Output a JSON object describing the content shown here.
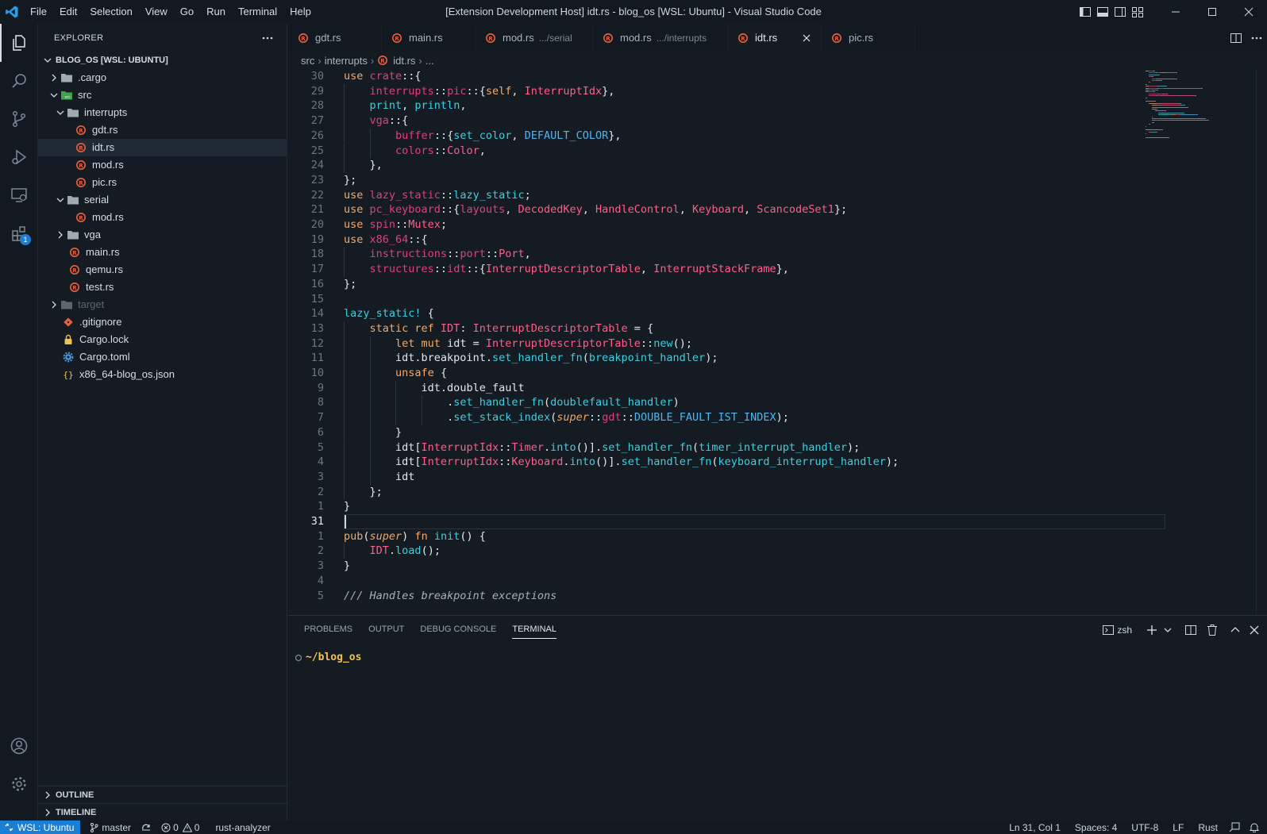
{
  "window": {
    "title": "[Extension Development Host] idt.rs - blog_os [WSL: Ubuntu] - Visual Studio Code",
    "menus": [
      "File",
      "Edit",
      "Selection",
      "View",
      "Go",
      "Run",
      "Terminal",
      "Help"
    ]
  },
  "colors": {
    "accent": "#1a7fd4",
    "rust_icon": "#e8613c",
    "folder": "#b9c3cc"
  },
  "activity": {
    "extensions_badge": "1"
  },
  "sidebar": {
    "title": "EXPLORER",
    "root": "BLOG_OS [WSL: UBUNTU]",
    "tree": [
      {
        "label": ".cargo",
        "depth": 1,
        "type": "folder",
        "expanded": false
      },
      {
        "label": "src",
        "depth": 1,
        "type": "folder-src",
        "expanded": true
      },
      {
        "label": "interrupts",
        "depth": 2,
        "type": "folder",
        "expanded": true
      },
      {
        "label": "gdt.rs",
        "depth": 3,
        "type": "rust"
      },
      {
        "label": "idt.rs",
        "depth": 3,
        "type": "rust",
        "selected": true
      },
      {
        "label": "mod.rs",
        "depth": 3,
        "type": "rust"
      },
      {
        "label": "pic.rs",
        "depth": 3,
        "type": "rust"
      },
      {
        "label": "serial",
        "depth": 2,
        "type": "folder",
        "expanded": true
      },
      {
        "label": "mod.rs",
        "depth": 3,
        "type": "rust"
      },
      {
        "label": "vga",
        "depth": 2,
        "type": "folder",
        "expanded": false
      },
      {
        "label": "main.rs",
        "depth": 2,
        "type": "rust"
      },
      {
        "label": "qemu.rs",
        "depth": 2,
        "type": "rust"
      },
      {
        "label": "test.rs",
        "depth": 2,
        "type": "rust"
      },
      {
        "label": "target",
        "depth": 1,
        "type": "folder-dim",
        "expanded": false
      },
      {
        "label": ".gitignore",
        "depth": 1,
        "type": "git"
      },
      {
        "label": "Cargo.lock",
        "depth": 1,
        "type": "lock"
      },
      {
        "label": "Cargo.toml",
        "depth": 1,
        "type": "gear"
      },
      {
        "label": "x86_64-blog_os.json",
        "depth": 1,
        "type": "json"
      }
    ],
    "sections": [
      "OUTLINE",
      "TIMELINE"
    ]
  },
  "tabs": [
    {
      "label": "gdt.rs",
      "desc": ""
    },
    {
      "label": "main.rs",
      "desc": ""
    },
    {
      "label": "mod.rs",
      "desc": ".../serial"
    },
    {
      "label": "mod.rs",
      "desc": ".../interrupts"
    },
    {
      "label": "idt.rs",
      "desc": "",
      "active": true
    },
    {
      "label": "pic.rs",
      "desc": ""
    }
  ],
  "breadcrumb": {
    "parts": [
      "src",
      "interrupts",
      "idt.rs",
      "..."
    ]
  },
  "editor": {
    "cursor_line": 31,
    "lines": [
      {
        "n": "30",
        "indent": 0,
        "t": [
          [
            "kw",
            "use "
          ],
          [
            "md",
            "crate"
          ],
          [
            "pn",
            "::{"
          ]
        ]
      },
      {
        "n": "29",
        "indent": 1,
        "t": [
          [
            "md",
            "interrupts"
          ],
          [
            "pn",
            "::"
          ],
          [
            "md",
            "pic"
          ],
          [
            "pn",
            "::{"
          ],
          [
            "kw",
            "self"
          ],
          [
            "pn",
            ", "
          ],
          [
            "ty",
            "InterruptIdx"
          ],
          [
            "pn",
            "},"
          ]
        ]
      },
      {
        "n": "28",
        "indent": 1,
        "t": [
          [
            "mac",
            "print"
          ],
          [
            "pn",
            ", "
          ],
          [
            "mac",
            "println"
          ],
          [
            "pn",
            ","
          ]
        ]
      },
      {
        "n": "27",
        "indent": 1,
        "t": [
          [
            "md",
            "vga"
          ],
          [
            "pn",
            "::{"
          ]
        ]
      },
      {
        "n": "26",
        "indent": 2,
        "t": [
          [
            "md",
            "buffer"
          ],
          [
            "pn",
            "::{"
          ],
          [
            "fn",
            "set_color"
          ],
          [
            "pn",
            ", "
          ],
          [
            "cst",
            "DEFAULT_COLOR"
          ],
          [
            "pn",
            "},"
          ]
        ]
      },
      {
        "n": "25",
        "indent": 2,
        "t": [
          [
            "md",
            "colors"
          ],
          [
            "pn",
            "::"
          ],
          [
            "ty",
            "Color"
          ],
          [
            "pn",
            ","
          ]
        ]
      },
      {
        "n": "24",
        "indent": 1,
        "t": [
          [
            "pn",
            "},"
          ]
        ]
      },
      {
        "n": "23",
        "indent": 0,
        "t": [
          [
            "pn",
            "};"
          ]
        ]
      },
      {
        "n": "22",
        "indent": 0,
        "t": [
          [
            "kw",
            "use "
          ],
          [
            "md",
            "lazy_static"
          ],
          [
            "pn",
            "::"
          ],
          [
            "mac",
            "lazy_static"
          ],
          [
            "pn",
            ";"
          ]
        ]
      },
      {
        "n": "21",
        "indent": 0,
        "t": [
          [
            "kw",
            "use "
          ],
          [
            "md",
            "pc_keyboard"
          ],
          [
            "pn",
            "::{"
          ],
          [
            "md",
            "layouts"
          ],
          [
            "pn",
            ", "
          ],
          [
            "ty",
            "DecodedKey"
          ],
          [
            "pn",
            ", "
          ],
          [
            "ty",
            "HandleControl"
          ],
          [
            "pn",
            ", "
          ],
          [
            "ty",
            "Keyboard"
          ],
          [
            "pn",
            ", "
          ],
          [
            "ty",
            "ScancodeSet1"
          ],
          [
            "pn",
            "};"
          ]
        ]
      },
      {
        "n": "20",
        "indent": 0,
        "t": [
          [
            "kw",
            "use "
          ],
          [
            "md",
            "spin"
          ],
          [
            "pn",
            "::"
          ],
          [
            "ty",
            "Mutex"
          ],
          [
            "pn",
            ";"
          ]
        ]
      },
      {
        "n": "19",
        "indent": 0,
        "t": [
          [
            "kw",
            "use "
          ],
          [
            "md",
            "x86_64"
          ],
          [
            "pn",
            "::{"
          ]
        ]
      },
      {
        "n": "18",
        "indent": 1,
        "t": [
          [
            "md",
            "instructions"
          ],
          [
            "pn",
            "::"
          ],
          [
            "md",
            "port"
          ],
          [
            "pn",
            "::"
          ],
          [
            "ty",
            "Port"
          ],
          [
            "pn",
            ","
          ]
        ]
      },
      {
        "n": "17",
        "indent": 1,
        "t": [
          [
            "md",
            "structures"
          ],
          [
            "pn",
            "::"
          ],
          [
            "md",
            "idt"
          ],
          [
            "pn",
            "::{"
          ],
          [
            "ty",
            "InterruptDescriptorTable"
          ],
          [
            "pn",
            ", "
          ],
          [
            "ty",
            "InterruptStackFrame"
          ],
          [
            "pn",
            "},"
          ]
        ]
      },
      {
        "n": "16",
        "indent": 0,
        "t": [
          [
            "pn",
            "};"
          ]
        ]
      },
      {
        "n": "15",
        "indent": 0,
        "t": []
      },
      {
        "n": "14",
        "indent": 0,
        "t": [
          [
            "mac",
            "lazy_static!"
          ],
          [
            "pn",
            " {"
          ]
        ]
      },
      {
        "n": "13",
        "indent": 1,
        "t": [
          [
            "kw",
            "static ref "
          ],
          [
            "ty",
            "IDT"
          ],
          [
            "pn",
            ": "
          ],
          [
            "ty",
            "InterruptDescriptorTable"
          ],
          [
            "pn",
            " = {"
          ]
        ]
      },
      {
        "n": "12",
        "indent": 2,
        "t": [
          [
            "kw",
            "let mut "
          ],
          [
            "pn",
            "idt = "
          ],
          [
            "ty",
            "InterruptDescriptorTable"
          ],
          [
            "pn",
            "::"
          ],
          [
            "fn",
            "new"
          ],
          [
            "pn",
            "();"
          ]
        ]
      },
      {
        "n": "11",
        "indent": 2,
        "t": [
          [
            "pn",
            "idt.breakpoint."
          ],
          [
            "fn",
            "set_handler_fn"
          ],
          [
            "pn",
            "("
          ],
          [
            "fn",
            "breakpoint_handler"
          ],
          [
            "pn",
            ");"
          ]
        ]
      },
      {
        "n": "10",
        "indent": 2,
        "t": [
          [
            "kw",
            "unsafe"
          ],
          [
            "pn",
            " {"
          ]
        ]
      },
      {
        "n": "9",
        "indent": 3,
        "t": [
          [
            "pn",
            "idt.double_fault"
          ]
        ]
      },
      {
        "n": "8",
        "indent": 4,
        "t": [
          [
            "pn",
            "."
          ],
          [
            "fn",
            "set_handler_fn"
          ],
          [
            "pn",
            "("
          ],
          [
            "fn",
            "doublefault_handler"
          ],
          [
            "pn",
            ")"
          ]
        ]
      },
      {
        "n": "7",
        "indent": 4,
        "t": [
          [
            "pn",
            "."
          ],
          [
            "fn",
            "set_stack_index"
          ],
          [
            "pn",
            "("
          ],
          [
            "it",
            "super"
          ],
          [
            "pn",
            "::"
          ],
          [
            "md",
            "gdt"
          ],
          [
            "pn",
            "::"
          ],
          [
            "cst",
            "DOUBLE_FAULT_IST_INDEX"
          ],
          [
            "pn",
            ");"
          ]
        ]
      },
      {
        "n": "6",
        "indent": 2,
        "t": [
          [
            "pn",
            "}"
          ]
        ]
      },
      {
        "n": "5",
        "indent": 2,
        "t": [
          [
            "pn",
            "idt["
          ],
          [
            "ty",
            "InterruptIdx"
          ],
          [
            "pn",
            "::"
          ],
          [
            "ty",
            "Timer"
          ],
          [
            "pn",
            "."
          ],
          [
            "fn",
            "into"
          ],
          [
            "pn",
            "()]."
          ],
          [
            "fn",
            "set_handler_fn"
          ],
          [
            "pn",
            "("
          ],
          [
            "fn",
            "timer_interrupt_handler"
          ],
          [
            "pn",
            ");"
          ]
        ]
      },
      {
        "n": "4",
        "indent": 2,
        "t": [
          [
            "pn",
            "idt["
          ],
          [
            "ty",
            "InterruptIdx"
          ],
          [
            "pn",
            "::"
          ],
          [
            "ty",
            "Keyboard"
          ],
          [
            "pn",
            "."
          ],
          [
            "fn",
            "into"
          ],
          [
            "pn",
            "()]."
          ],
          [
            "fn",
            "set_handler_fn"
          ],
          [
            "pn",
            "("
          ],
          [
            "fn",
            "keyboard_interrupt_handler"
          ],
          [
            "pn",
            ");"
          ]
        ]
      },
      {
        "n": "3",
        "indent": 2,
        "t": [
          [
            "pn",
            "idt"
          ]
        ]
      },
      {
        "n": "2",
        "indent": 1,
        "t": [
          [
            "pn",
            "};"
          ]
        ]
      },
      {
        "n": "1",
        "indent": 0,
        "t": [
          [
            "pn",
            "}"
          ]
        ]
      },
      {
        "n": "31",
        "indent": 0,
        "t": [],
        "cur": true
      },
      {
        "n": "1",
        "indent": 0,
        "t": [
          [
            "kw",
            "pub"
          ],
          [
            "pn",
            "("
          ],
          [
            "it",
            "super"
          ],
          [
            "pn",
            ") "
          ],
          [
            "kw",
            "fn "
          ],
          [
            "fn",
            "init"
          ],
          [
            "pn",
            "() {"
          ]
        ]
      },
      {
        "n": "2",
        "indent": 1,
        "t": [
          [
            "ty",
            "IDT"
          ],
          [
            "pn",
            "."
          ],
          [
            "fn",
            "load"
          ],
          [
            "pn",
            "();"
          ]
        ]
      },
      {
        "n": "3",
        "indent": 0,
        "t": [
          [
            "pn",
            "}"
          ]
        ]
      },
      {
        "n": "4",
        "indent": 0,
        "t": []
      },
      {
        "n": "5",
        "indent": 0,
        "t": [
          [
            "cm",
            "/// Handles breakpoint exceptions"
          ]
        ]
      }
    ]
  },
  "panel": {
    "tabs": [
      "PROBLEMS",
      "OUTPUT",
      "DEBUG CONSOLE",
      "TERMINAL"
    ],
    "active_tab": "TERMINAL",
    "shell": "zsh",
    "prompt": "~/blog_os"
  },
  "statusbar": {
    "remote": "WSL: Ubuntu",
    "branch": "master",
    "errors": "0",
    "warnings": "0",
    "language_server": "rust-analyzer",
    "position": "Ln 31, Col 1",
    "spaces": "Spaces: 4",
    "encoding": "UTF-8",
    "eol": "LF",
    "language": "Rust"
  }
}
